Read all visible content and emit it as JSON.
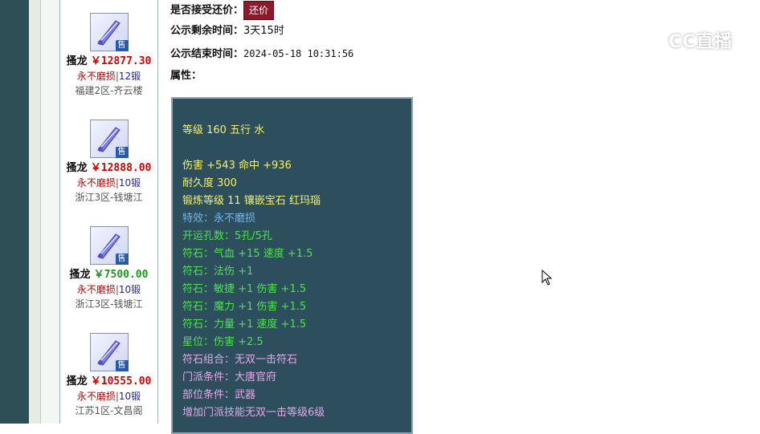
{
  "listings": [
    {
      "name": "搔龙",
      "price": "￥12877.30",
      "price_color": "#d40000",
      "wear": "永不磨损",
      "separator": "|",
      "forge": "12锻",
      "server": "福建2区-齐云楼",
      "badge": "售"
    },
    {
      "name": "搔龙",
      "price": "￥12888.00",
      "price_color": "#d40000",
      "wear": "永不磨损",
      "separator": "|",
      "forge": "10锻",
      "server": "浙江3区-钱塘江",
      "badge": "售"
    },
    {
      "name": "搔龙",
      "price": "￥7500.00",
      "price_color": "#1a9a1a",
      "wear": "永不磨损",
      "separator": "|",
      "forge": "10锻",
      "server": "浙江3区-钱塘江",
      "badge": "售"
    },
    {
      "name": "搔龙",
      "price": "￥10555.00",
      "price_color": "#d40000",
      "wear": "永不磨损",
      "separator": "|",
      "forge": "10锻",
      "server": "江苏1区-文昌阁",
      "badge": "售"
    }
  ],
  "detail": {
    "counter_offer_label": "是否接受还价：",
    "counter_offer_button": "还价",
    "remaining_label": "公示剩余时间：",
    "remaining_value": "3天15时",
    "end_label": "公示结束时间：",
    "end_value": "2024-05-18 10:31:56",
    "attributes_label": "属性："
  },
  "attributes": [
    {
      "text": "等级 160 五行 水",
      "color": "yellow"
    },
    {
      "text": "伤害 +543 命中 +936",
      "color": "yellow"
    },
    {
      "text": "耐久度 300",
      "color": "yellow"
    },
    {
      "text": "锻炼等级 11 镶嵌宝石 红玛瑙",
      "color": "yellow"
    },
    {
      "text": "特效：永不磨损",
      "color": "blue"
    },
    {
      "text": "开运孔数：5孔/5孔",
      "color": "green"
    },
    {
      "text": "符石：气血 +15 速度 +1.5",
      "color": "green"
    },
    {
      "text": "符石：法伤 +1",
      "color": "green"
    },
    {
      "text": "符石：敏捷 +1 伤害 +1.5",
      "color": "green"
    },
    {
      "text": "符石：魔力 +1 伤害 +1.5",
      "color": "green"
    },
    {
      "text": "符石：力量 +1 速度 +1.5",
      "color": "green"
    },
    {
      "text": "星位：伤害 +2.5",
      "color": "green"
    },
    {
      "text": "符石组合：无双一击符石",
      "color": "pink"
    },
    {
      "text": "门派条件：大唐官府",
      "color": "pink"
    },
    {
      "text": "部位条件：武器",
      "color": "pink"
    },
    {
      "text": "增加门派技能无双一击等级6级",
      "color": "pink"
    }
  ],
  "watermark": {
    "text": "CC直播",
    "icon": "cc-live-logo-icon"
  },
  "colors": {
    "accent_button": "#8c1a2c",
    "attr_bg": "#2d4f5d",
    "price_red": "#d40000",
    "price_green": "#1a9a1a"
  }
}
